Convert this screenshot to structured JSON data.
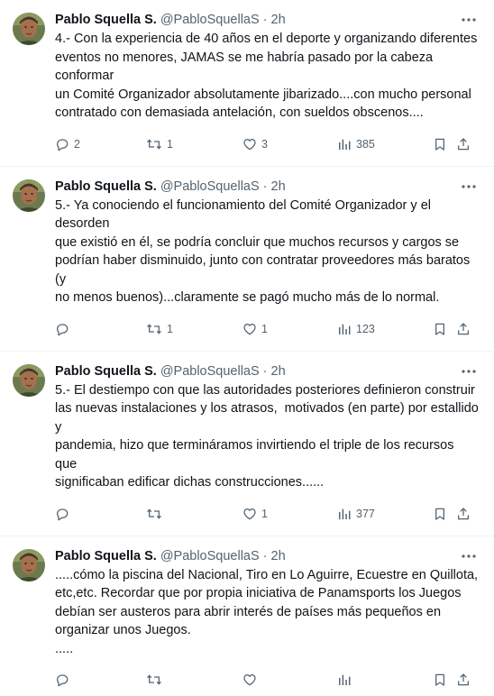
{
  "tweets": [
    {
      "name": "Pablo Squella S.",
      "handle": "@PabloSquellaS",
      "dot": "·",
      "time": "2h",
      "text": "4.- Con la experiencia de 40 años en el deporte y organizando diferentes\neventos no menores, JAMAS se me habría pasado por la cabeza conformar\nun Comité Organizador absolutamente jibarizado....con mucho personal\ncontratado con demasiada antelación, con sueldos obscenos....",
      "replies": "2",
      "reposts": "1",
      "likes": "3",
      "views": "385"
    },
    {
      "name": "Pablo Squella S.",
      "handle": "@PabloSquellaS",
      "dot": "·",
      "time": "2h",
      "text": "5.- Ya conociendo el funcionamiento del Comité Organizador y el desorden\nque existió en él, se podría concluir que muchos recursos y cargos se\npodrían haber disminuido, junto con contratar proveedores más baratos (y\nno menos buenos)...claramente se pagó mucho más de lo normal.",
      "replies": "",
      "reposts": "1",
      "likes": "1",
      "views": "123"
    },
    {
      "name": "Pablo Squella S.",
      "handle": "@PabloSquellaS",
      "dot": "·",
      "time": "2h",
      "text": "5.- El destiempo con que las autoridades posteriores definieron construir\nlas nuevas instalaciones y los atrasos,  motivados (en parte) por estallido y\npandemia, hizo que termináramos invirtiendo el triple de los recursos que\nsignificaban edificar dichas construcciones......",
      "replies": "",
      "reposts": "",
      "likes": "1",
      "views": "377"
    },
    {
      "name": "Pablo Squella S.",
      "handle": "@PabloSquellaS",
      "dot": "·",
      "time": "2h",
      "text": ".....cómo la piscina del Nacional, Tiro en Lo Aguirre, Ecuestre en Quillota,\netc,etc. Recordar que por propia iniciativa de Panamsports los Juegos\ndebían ser austeros para abrir interés de países más pequeños en\norganizar unos Juegos.\n.....",
      "replies": "",
      "reposts": "",
      "likes": "",
      "views": ""
    }
  ],
  "icons": {
    "more": "more-horizontal-icon",
    "reply": "reply-bubble-icon",
    "repost": "repost-arrows-icon",
    "like": "heart-icon",
    "views": "analytics-bars-icon",
    "bookmark": "bookmark-icon",
    "share": "share-icon"
  },
  "colors": {
    "text": "#0f1419",
    "secondary": "#536471",
    "divider": "#eff3f4"
  }
}
